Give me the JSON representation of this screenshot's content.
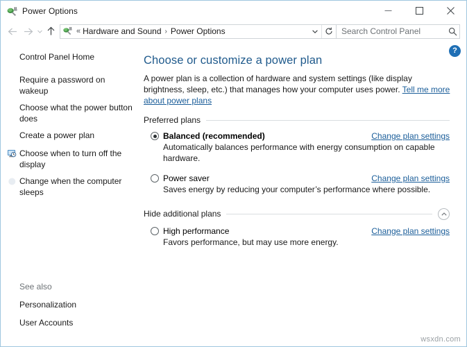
{
  "window": {
    "title": "Power Options",
    "title_icon": "power-plug-icon",
    "controls": {
      "minimize": "minimize-icon",
      "maximize": "maximize-icon",
      "close": "close-icon"
    }
  },
  "navbar": {
    "back": "back-arrow-icon",
    "forward": "forward-arrow-icon",
    "recent_chevron": "chevron-down-icon",
    "up": "up-arrow-icon",
    "address_icon": "power-plug-icon",
    "breadcrumb_prefix": "«",
    "breadcrumbs": [
      "Hardware and Sound",
      "Power Options"
    ],
    "breadcrumb_separator": "›",
    "dropdown": "chevron-down-icon",
    "refresh": "refresh-icon",
    "search": {
      "value": "",
      "placeholder": "Search Control Panel",
      "icon": "search-icon"
    }
  },
  "sidebar": {
    "home_label": "Control Panel Home",
    "items": [
      {
        "label": "Require a password on wakeup",
        "icon": ""
      },
      {
        "label": "Choose what the power button does",
        "icon": ""
      },
      {
        "label": "Create a power plan",
        "icon": ""
      },
      {
        "label": "Choose when to turn off the display",
        "icon": "monitor-clock-icon"
      },
      {
        "label": "Change when the computer sleeps",
        "icon": "moon-icon"
      }
    ],
    "see_also": {
      "title": "See also",
      "items": [
        "Personalization",
        "User Accounts"
      ]
    }
  },
  "content": {
    "help_button": "?",
    "heading": "Choose or customize a power plan",
    "intro_text": "A power plan is a collection of hardware and system settings (like display brightness, sleep, etc.) that manages how your computer uses power. ",
    "intro_link": "Tell me more about power plans",
    "sections": [
      {
        "title": "Preferred plans",
        "collapsible": false,
        "plans": [
          {
            "name": "Balanced (recommended)",
            "bold": true,
            "selected": true,
            "description": "Automatically balances performance with energy consumption on capable hardware.",
            "link": "Change plan settings",
            "link_underlined": true
          },
          {
            "name": "Power saver",
            "bold": false,
            "selected": false,
            "description": "Saves energy by reducing your computer’s performance where possible.",
            "link": "Change plan settings",
            "link_underlined": false
          }
        ]
      },
      {
        "title": "Hide additional plans",
        "collapsible": true,
        "collapse_icon": "chevron-up-circle-icon",
        "plans": [
          {
            "name": "High performance",
            "bold": false,
            "selected": false,
            "description": "Favors performance, but may use more energy.",
            "link": "Change plan settings",
            "link_underlined": false
          }
        ]
      }
    ]
  },
  "watermark": "wsxdn.com",
  "colors": {
    "heading": "#1f5a8c",
    "link": "#1a5d99",
    "help_badge": "#1f6fb5",
    "window_border": "#9fc6df",
    "rule": "#d9dde0"
  }
}
